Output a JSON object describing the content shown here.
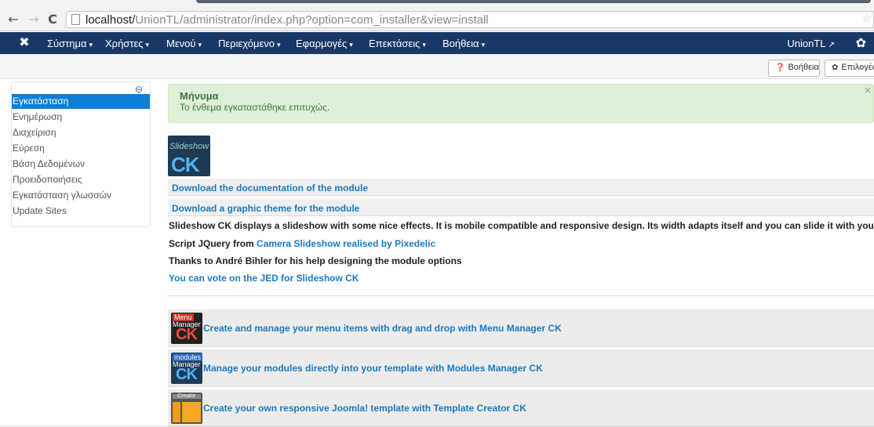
{
  "browser": {
    "url_host": "localhost/",
    "url_path": "UnionTL/administrator/index.php?option=com_installer&view=install"
  },
  "navbar": {
    "menu": [
      {
        "label": "Σύστημα"
      },
      {
        "label": "Χρήστες"
      },
      {
        "label": "Μενού"
      },
      {
        "label": "Περιεχόμενο"
      },
      {
        "label": "Εφαρμογές"
      },
      {
        "label": "Επεκτάσεις"
      },
      {
        "label": "Βοήθεια"
      }
    ],
    "site_name": "UnionTL"
  },
  "toolbar": {
    "help_label": "Βοήθεια",
    "options_label": "Επιλογές"
  },
  "sidebar": {
    "items": [
      {
        "label": "Εγκατάσταση",
        "active": true
      },
      {
        "label": "Ενημέρωση"
      },
      {
        "label": "Διαχείριση"
      },
      {
        "label": "Εύρεση"
      },
      {
        "label": "Βάση Δεδομένων"
      },
      {
        "label": "Προειδοποιήσεις"
      },
      {
        "label": "Εγκατάσταση γλωσσών"
      },
      {
        "label": "Update Sites"
      }
    ]
  },
  "message": {
    "title": "Μήνυμα",
    "text": "Το ένθεμα εγκαταστάθηκε επιτυχώς."
  },
  "module": {
    "logo_top": "Slideshow",
    "logo_bottom": "CK",
    "doc_link": "Download the documentation of the module",
    "theme_link": "Download a graphic theme for the module",
    "description": "Slideshow CK displays a slideshow with some nice effects. It is mobile compatible and responsive design. Its width adapts itself and you can slide it with your fingers.",
    "script_prefix": "Script JQuery from ",
    "script_link": "Camera Slideshow realised by Pixedelic",
    "thanks": "Thanks to André Bihler for his help designing the module options",
    "vote_link": "You can vote on the JED for Slideshow CK"
  },
  "promos": [
    {
      "thumb_a": "Menu",
      "thumb_b": "Manager",
      "thumb_c": "CK",
      "text": "Create and manage your menu items with drag and drop with Menu Manager CK"
    },
    {
      "thumb_a": "modules",
      "thumb_b": "Manager",
      "thumb_c": "CK",
      "text": "Manage your modules directly into your template with Modules Manager CK"
    },
    {
      "thumb_a": "Creator",
      "text": "Create your own responsive Joomla! template with Template Creator CK"
    }
  ]
}
